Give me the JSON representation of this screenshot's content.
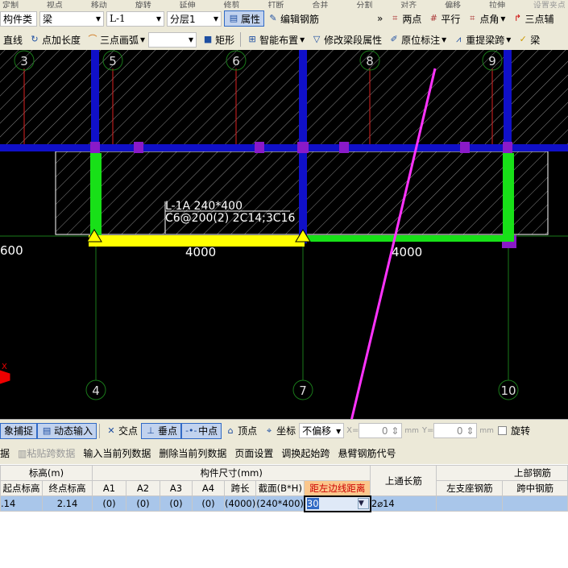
{
  "toolbar_top": {
    "items": [
      "定制",
      "视点",
      "移动",
      "旋转",
      "延伸",
      "修剪",
      "打断",
      "合并",
      "分割",
      "对齐",
      "偏移",
      "拉伸",
      "设置夹点"
    ]
  },
  "toolbar2": {
    "type_label": "构件类",
    "type_value": "梁",
    "name_value": "L-1",
    "floor_value": "分层1",
    "properties": "属性",
    "edit_rebar": "编辑钢筋",
    "more": "»",
    "two_point": "两点",
    "parallel": "平行",
    "point_angle": "点角",
    "three_point": "三点辅"
  },
  "toolbar3": {
    "line": "直线",
    "point_length": "点加长度",
    "three_arc": "三点画弧",
    "rect": "矩形",
    "smart_layout": "智能布置",
    "modify_segment": "修改梁段属性",
    "in_situ": "原位标注",
    "re_extract": "重提梁跨",
    "beam": "梁"
  },
  "cad": {
    "axis_top": [
      "3",
      "5",
      "6",
      "8",
      "9"
    ],
    "axis_bottom": [
      "4",
      "7",
      "10"
    ],
    "beam_label_1": "L-1A 240*400",
    "beam_label_2": "C6@200(2) 2C14;3C16",
    "dim_1": "4000",
    "dim_2": "4000",
    "dim_left": "600",
    "annotation_color": "#ff33ff"
  },
  "snap_bar": {
    "object_snap": "象捕捉",
    "dynamic_input": "动态输入",
    "intersection": "交点",
    "perpendicular": "垂点",
    "midpoint": "中点",
    "vertex": "顶点",
    "coordinate": "坐标",
    "offset": "不偏移",
    "x_label": "X=",
    "x_value": "0",
    "y_label": "Y=",
    "y_value": "0",
    "unit": "mm",
    "rotate": "旋转"
  },
  "grid_menu": [
    "据",
    "粘贴跨数据",
    "输入当前列数据",
    "删除当前列数据",
    "页面设置",
    "调换起始跨",
    "悬臂钢筋代号"
  ],
  "table": {
    "group_headers": [
      "标高(m)",
      "构件尺寸(mm)",
      "上通长筋",
      "上部钢筋"
    ],
    "columns": [
      "起点标高",
      "终点标高",
      "A1",
      "A2",
      "A3",
      "A4",
      "跨长",
      "截面(B*H)",
      "距左边线距离",
      "左支座钢筋",
      "跨中钢筋"
    ],
    "row": {
      "start": ".14",
      "end": "2.14",
      "a1": "(0)",
      "a2": "(0)",
      "a3": "(0)",
      "a4": "(0)",
      "span": "(4000)",
      "section": "(240*400)",
      "offset": "30",
      "top_through": "2⌀14",
      "left_support": "",
      "mid": ""
    }
  }
}
